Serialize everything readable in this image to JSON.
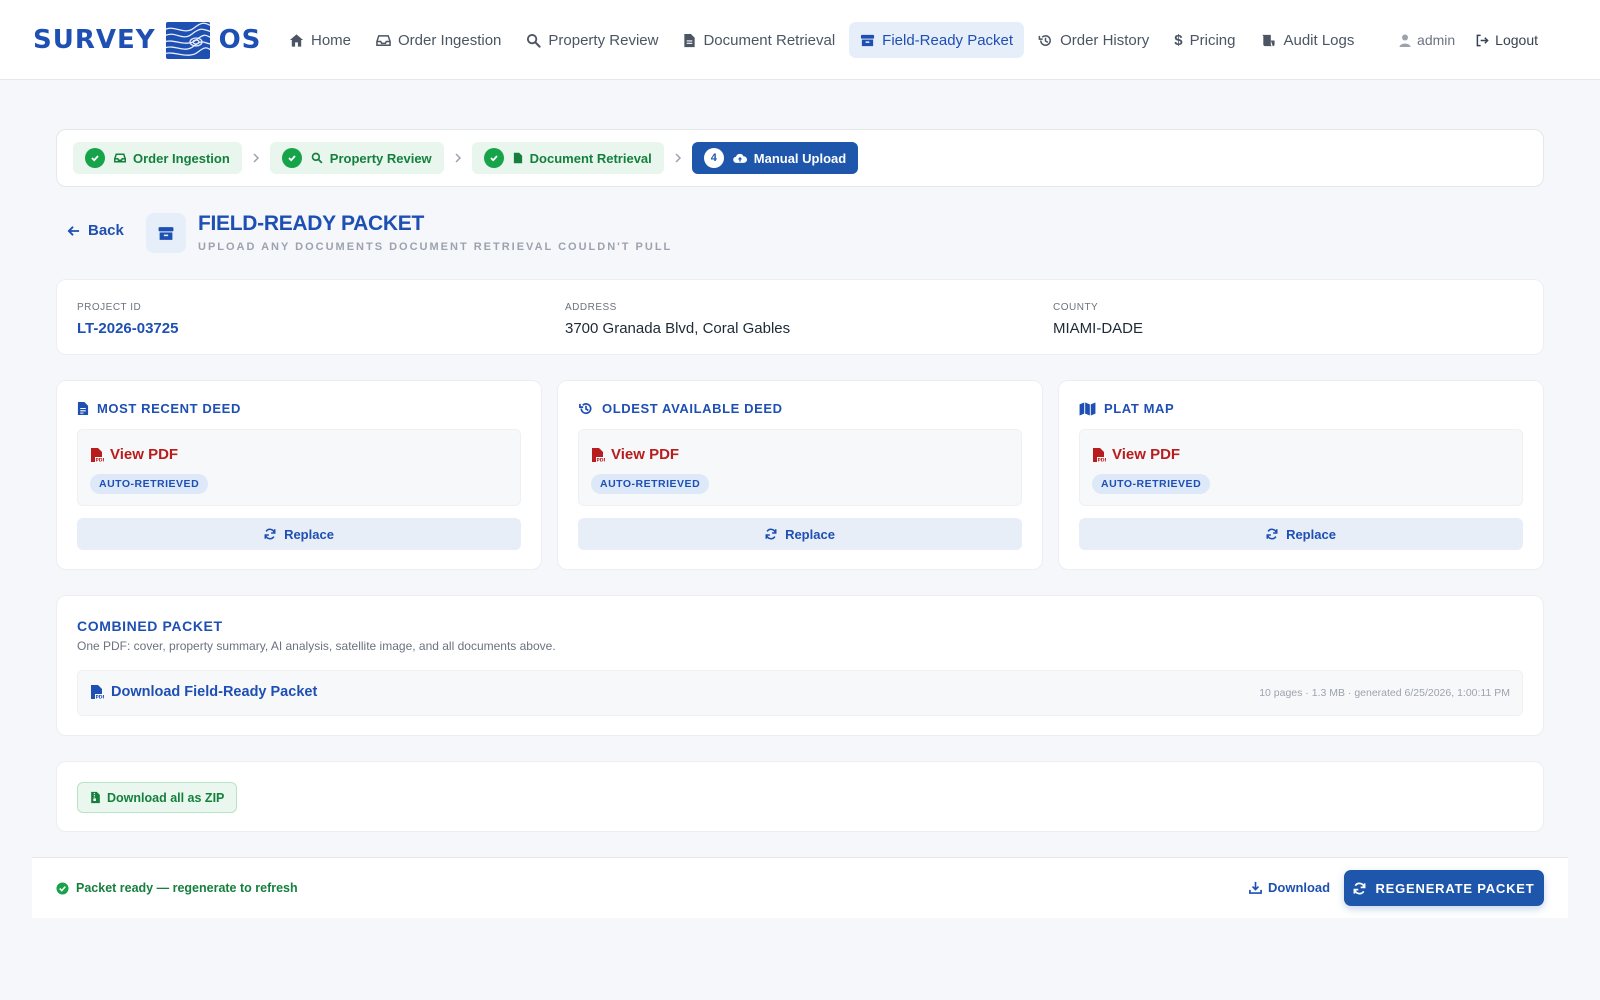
{
  "app": {
    "logo_left": "SURVEY",
    "logo_right": "OS"
  },
  "nav": {
    "items": [
      {
        "label": "Home",
        "icon": "home-icon"
      },
      {
        "label": "Order Ingestion",
        "icon": "inbox-icon"
      },
      {
        "label": "Property Review",
        "icon": "magnify-icon"
      },
      {
        "label": "Document Retrieval",
        "icon": "file-icon"
      },
      {
        "label": "Field-Ready Packet",
        "icon": "archive-icon",
        "active": true
      },
      {
        "label": "Order History",
        "icon": "history-icon"
      },
      {
        "label": "Pricing",
        "icon": "dollar-icon"
      },
      {
        "label": "Audit Logs",
        "icon": "scroll-icon"
      }
    ],
    "user": "admin",
    "logout": "Logout"
  },
  "stepper": {
    "steps": [
      {
        "label": "Order Ingestion",
        "state": "done"
      },
      {
        "label": "Property Review",
        "state": "done"
      },
      {
        "label": "Document Retrieval",
        "state": "done"
      },
      {
        "label": "Manual Upload",
        "state": "current",
        "number": "4"
      }
    ]
  },
  "header": {
    "back": "Back",
    "title": "FIELD-READY PACKET",
    "subtitle": "UPLOAD ANY DOCUMENTS DOCUMENT RETRIEVAL COULDN'T PULL"
  },
  "info": {
    "project_label": "PROJECT ID",
    "project_value": "LT-2026-03725",
    "address_label": "ADDRESS",
    "address_value": "3700 Granada Blvd, Coral Gables",
    "county_label": "COUNTY",
    "county_value": "MIAMI-DADE"
  },
  "documents": [
    {
      "title": "MOST RECENT DEED",
      "view": "View PDF",
      "badge": "AUTO-RETRIEVED",
      "replace": "Replace"
    },
    {
      "title": "OLDEST AVAILABLE DEED",
      "view": "View PDF",
      "badge": "AUTO-RETRIEVED",
      "replace": "Replace"
    },
    {
      "title": "PLAT MAP",
      "view": "View PDF",
      "badge": "AUTO-RETRIEVED",
      "replace": "Replace"
    }
  ],
  "combined": {
    "title": "COMBINED PACKET",
    "description": "One PDF: cover, property summary, AI analysis, satellite image, and all documents above.",
    "download_label": "Download Field-Ready Packet",
    "meta": "10 pages · 1.3 MB · generated 6/25/2026, 1:00:11 PM"
  },
  "zip": {
    "label": "Download all as ZIP"
  },
  "footer": {
    "status": "Packet ready — regenerate to refresh",
    "download": "Download",
    "regenerate": "REGENERATE PACKET"
  },
  "colors": {
    "brand": "#1e4fb3",
    "success": "#15803d",
    "pdf": "#b91c1c"
  }
}
